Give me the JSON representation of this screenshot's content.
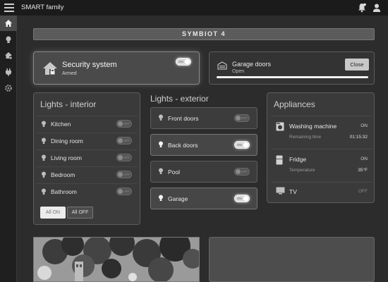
{
  "topbar": {
    "title": "SMART family"
  },
  "banner": {
    "text": "SYMBIOT 4"
  },
  "security": {
    "title": "Security system",
    "status": "Armed",
    "toggle_label": "ON",
    "on": true
  },
  "garage_doors": {
    "title": "Garage doors",
    "status": "Open",
    "button": "Close",
    "progress": 1.0
  },
  "lights_interior": {
    "title": "Lights - interior",
    "items": [
      {
        "label": "Kitchen",
        "toggle": "OFF"
      },
      {
        "label": "Dining room",
        "toggle": "OFF"
      },
      {
        "label": "Living room",
        "toggle": "OFF"
      },
      {
        "label": "Bedroom",
        "toggle": "OFF"
      },
      {
        "label": "Bathroom",
        "toggle": "OFF"
      }
    ],
    "all_on": "All ON",
    "all_off": "All OFF"
  },
  "lights_exterior": {
    "title": "Lights - exterior",
    "items": [
      {
        "label": "Front doors",
        "toggle": "OFF",
        "on": false
      },
      {
        "label": "Back doors",
        "toggle": "ON",
        "on": true
      },
      {
        "label": "Pool",
        "toggle": "OFF",
        "on": false
      },
      {
        "label": "Garage",
        "toggle": "ON",
        "on": true
      }
    ]
  },
  "appliances": {
    "title": "Appliances",
    "items": [
      {
        "name": "Washing machine",
        "state": "ON",
        "meta_label": "Remaining time",
        "meta_value": "01:15:32"
      },
      {
        "name": "Fridge",
        "state": "ON",
        "meta_label": "Temperature",
        "meta_value": "35°F"
      },
      {
        "name": "TV",
        "state": "OFF"
      }
    ]
  },
  "colors": {
    "background": "#2c2c2c",
    "panel": "#3a3a3a",
    "accent": "#ffffff"
  }
}
